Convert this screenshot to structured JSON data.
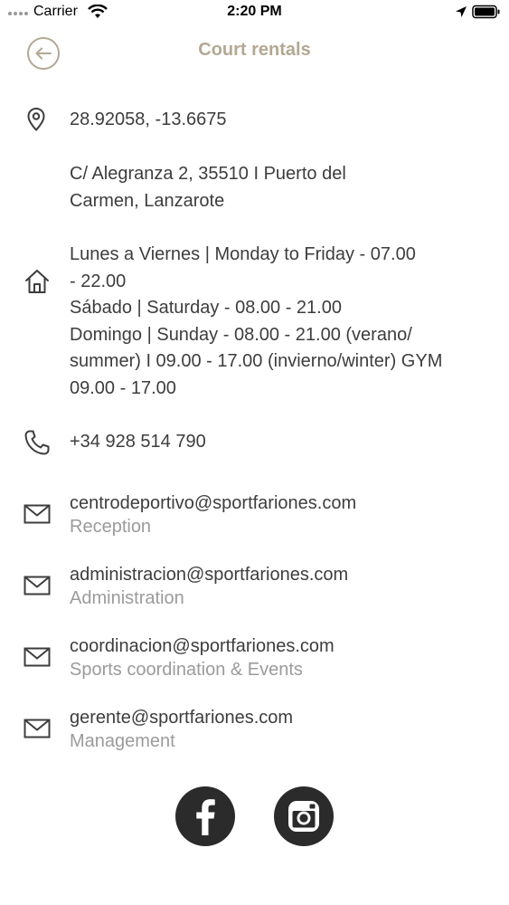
{
  "status_bar": {
    "carrier": "Carrier",
    "time": "2:20 PM"
  },
  "header": {
    "title": "Court rentals"
  },
  "info": {
    "coordinates": "28.92058, -13.6675",
    "address_lines": [
      "C/ Alegranza 2, 35510 I Puerto del",
      "Carmen, Lanzarote"
    ],
    "hours_lines": [
      "Lunes a Viernes | Monday to Friday - 07.00",
      "- 22.00",
      "Sábado | Saturday - 08.00 - 21.00",
      "Domingo | Sunday - 08.00 - 21.00 (verano/",
      "summer) I 09.00 - 17.00 (invierno/winter) GYM",
      "09.00 - 17.00"
    ],
    "phone": "+34 928 514 790"
  },
  "emails": [
    {
      "address": "centrodeportivo@sportfariones.com",
      "label": "Reception"
    },
    {
      "address": "administracion@sportfariones.com",
      "label": "Administration"
    },
    {
      "address": "coordinacion@sportfariones.com",
      "label": "Sports coordination & Events"
    },
    {
      "address": "gerente@sportfariones.com",
      "label": "Management"
    }
  ],
  "social": [
    "facebook-icon",
    "instagram-icon"
  ],
  "colors": {
    "accent": "#b3a893",
    "text": "#3d3d3d",
    "muted": "#9b9b9b",
    "social_bg": "#2b2b2b"
  }
}
